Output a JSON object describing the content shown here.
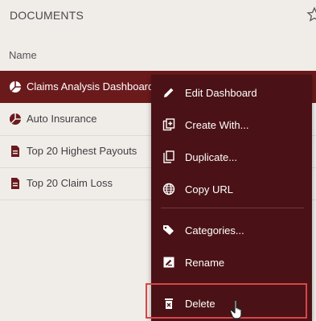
{
  "header": {
    "title": "DOCUMENTS"
  },
  "list": {
    "column_header": "Name",
    "rows": [
      {
        "label": "Claims Analysis Dashboard",
        "icon": "pie-chart-icon"
      },
      {
        "label": "Auto Insurance",
        "icon": "pie-chart-icon"
      },
      {
        "label": "Top 20 Highest Payouts",
        "icon": "document-icon"
      },
      {
        "label": "Top 20 Claim Loss",
        "icon": "document-icon"
      }
    ]
  },
  "menu": {
    "items": [
      {
        "label": "Edit Dashboard",
        "icon": "pencil-icon"
      },
      {
        "label": "Create With...",
        "icon": "create-with-icon"
      },
      {
        "label": "Duplicate...",
        "icon": "duplicate-icon"
      },
      {
        "label": "Copy URL",
        "icon": "globe-icon"
      },
      {
        "label": "Categories...",
        "icon": "tags-icon"
      },
      {
        "label": "Rename",
        "icon": "rename-icon"
      },
      {
        "label": "Delete",
        "icon": "trash-icon"
      }
    ]
  },
  "colors": {
    "selected_row": "#6b1a1c",
    "menu_background": "#4a1216",
    "highlight_border": "#d94548",
    "page_background": "#f0ede9"
  }
}
